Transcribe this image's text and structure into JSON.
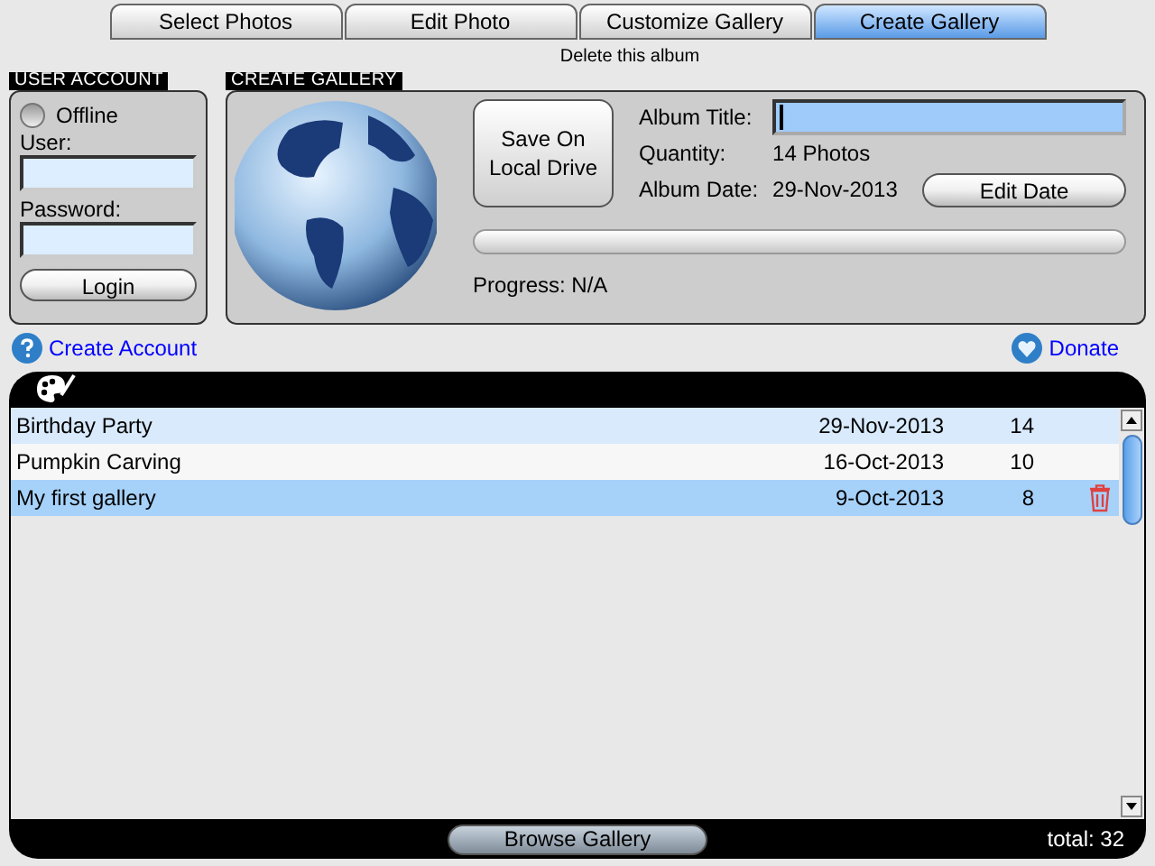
{
  "tabs": [
    {
      "label": "Select Photos",
      "selected": false
    },
    {
      "label": "Edit Photo",
      "selected": false
    },
    {
      "label": "Customize Gallery",
      "selected": false
    },
    {
      "label": "Create Gallery",
      "selected": true
    }
  ],
  "hint": "Delete this album",
  "user_account": {
    "title": "USER ACCOUNT",
    "status": {
      "label": "Offline",
      "checked": false
    },
    "user_label": "User:",
    "password_label": "Password:",
    "login": "Login"
  },
  "create_gallery": {
    "title": "CREATE GALLERY",
    "save_button": "Save On Local Drive",
    "album_title_label": "Album Title:",
    "quantity_label": "Quantity:",
    "quantity": "14 Photos",
    "date_label": "Album Date:",
    "date": "29-Nov-2013",
    "edit_date": "Edit Date",
    "progress": {
      "level": 0
    },
    "progress_text": "Progress: N/A"
  },
  "links": {
    "create_account": "Create Account",
    "donate": "Donate"
  },
  "galleries": [
    {
      "name": "Birthday Party",
      "date": "29-Nov-2013",
      "count": "14",
      "hovered": true,
      "selected": false
    },
    {
      "name": "Pumpkin Carving",
      "date": "16-Oct-2013",
      "count": "10",
      "hovered": false,
      "selected": false
    },
    {
      "name": "My first gallery",
      "date": "9-Oct-2013",
      "count": "8",
      "hovered": false,
      "selected": true
    }
  ],
  "browse_button": "Browse Gallery",
  "total": "total: 32"
}
